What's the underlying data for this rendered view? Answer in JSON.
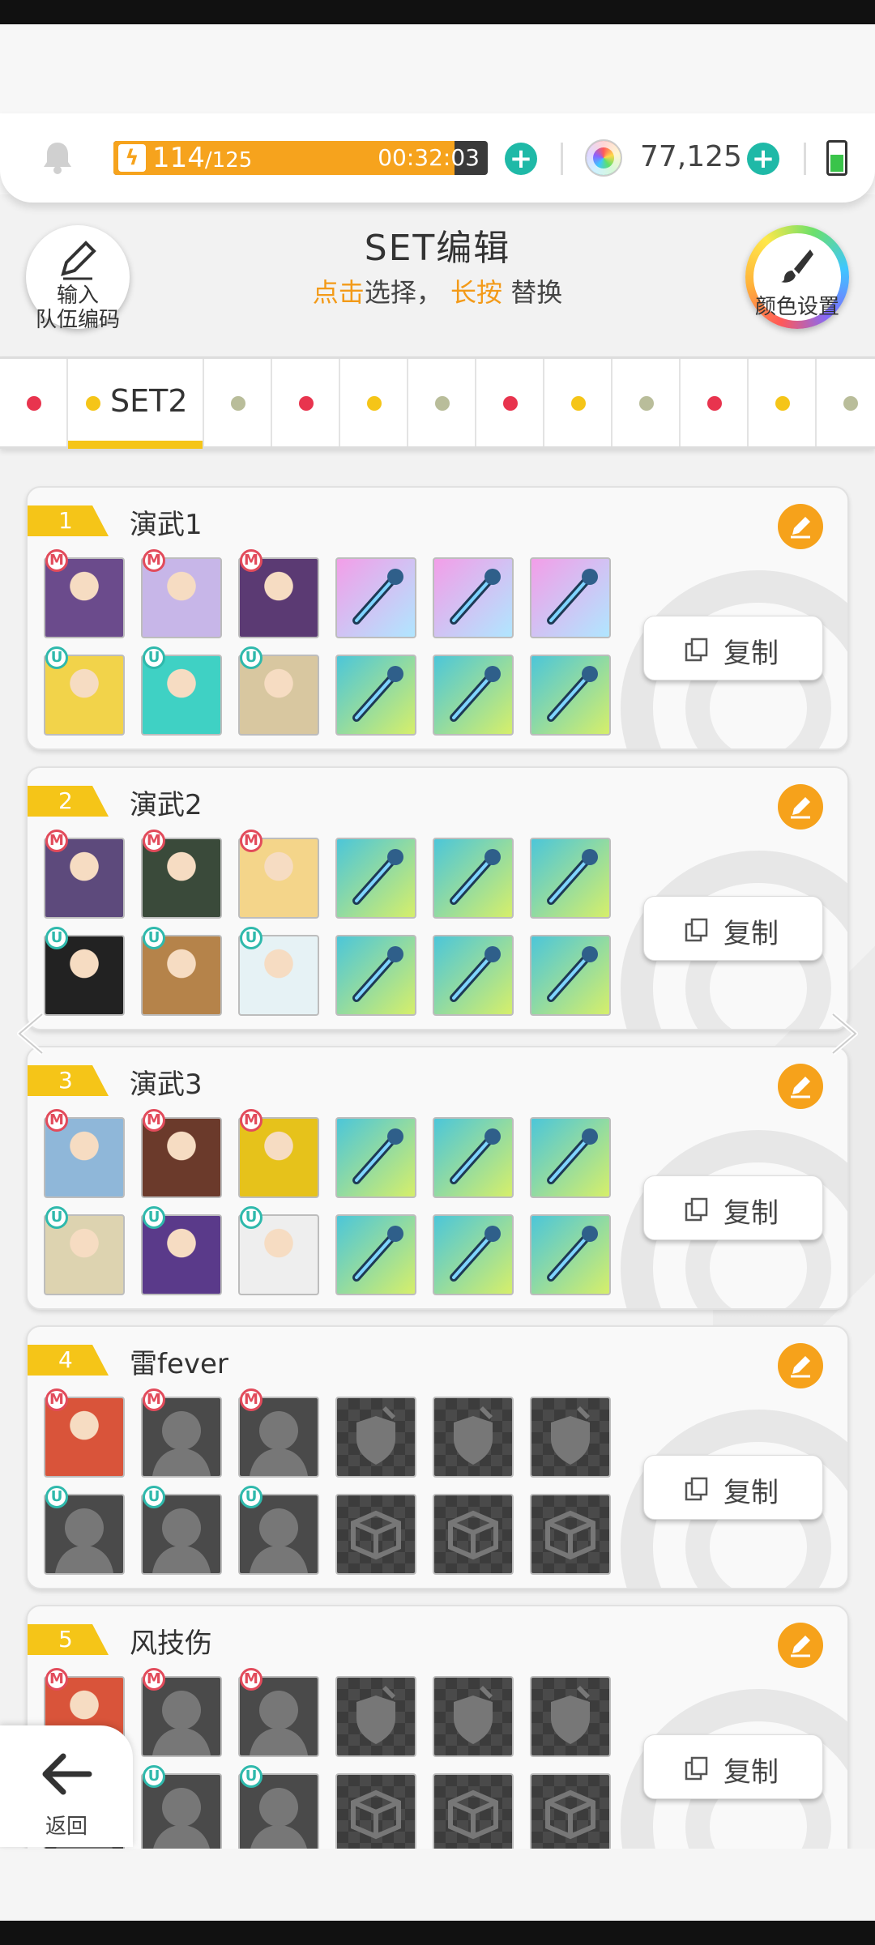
{
  "resources": {
    "stamina_current": "114",
    "stamina_max": "/125",
    "stamina_fraction": 0.912,
    "timer": "00:32:03",
    "gems": "77,125",
    "battery_level": 0.55
  },
  "header": {
    "title": "SET编辑",
    "hint_tap": "点击",
    "hint_select": "选择，",
    "hint_hold": "长按",
    "hint_replace": "替换",
    "team_code_line1": "输入",
    "team_code_line2": "队伍编码",
    "color_settings": "颜色设置"
  },
  "tabs": [
    {
      "color": "#e8344e",
      "label": ""
    },
    {
      "color": "#f5c518",
      "label": "SET2",
      "active": true
    },
    {
      "color": "#b9bd9a",
      "label": ""
    },
    {
      "color": "#e8344e",
      "label": ""
    },
    {
      "color": "#f5c518",
      "label": ""
    },
    {
      "color": "#b9bd9a",
      "label": ""
    },
    {
      "color": "#e8344e",
      "label": ""
    },
    {
      "color": "#f5c518",
      "label": ""
    },
    {
      "color": "#b9bd9a",
      "label": ""
    },
    {
      "color": "#e8344e",
      "label": ""
    },
    {
      "color": "#f5c518",
      "label": ""
    },
    {
      "color": "#b9bd9a",
      "label": ""
    }
  ],
  "sets": [
    {
      "number": "1",
      "name": "演武1",
      "copy_label": "复制",
      "filled": true
    },
    {
      "number": "2",
      "name": "演武2",
      "copy_label": "复制",
      "filled": true
    },
    {
      "number": "3",
      "name": "演武3",
      "copy_label": "复制",
      "filled": true
    },
    {
      "number": "4",
      "name": "雷fever",
      "copy_label": "复制",
      "filled": false
    },
    {
      "number": "5",
      "name": "风技伤",
      "copy_label": "复制",
      "filled": false
    }
  ],
  "badges": {
    "main": "M",
    "unison": "U"
  },
  "back_label": "返回",
  "colors": {
    "accent_orange": "#f6a21b",
    "teal": "#1fb9a7",
    "tab_yellow": "#f5c518"
  }
}
